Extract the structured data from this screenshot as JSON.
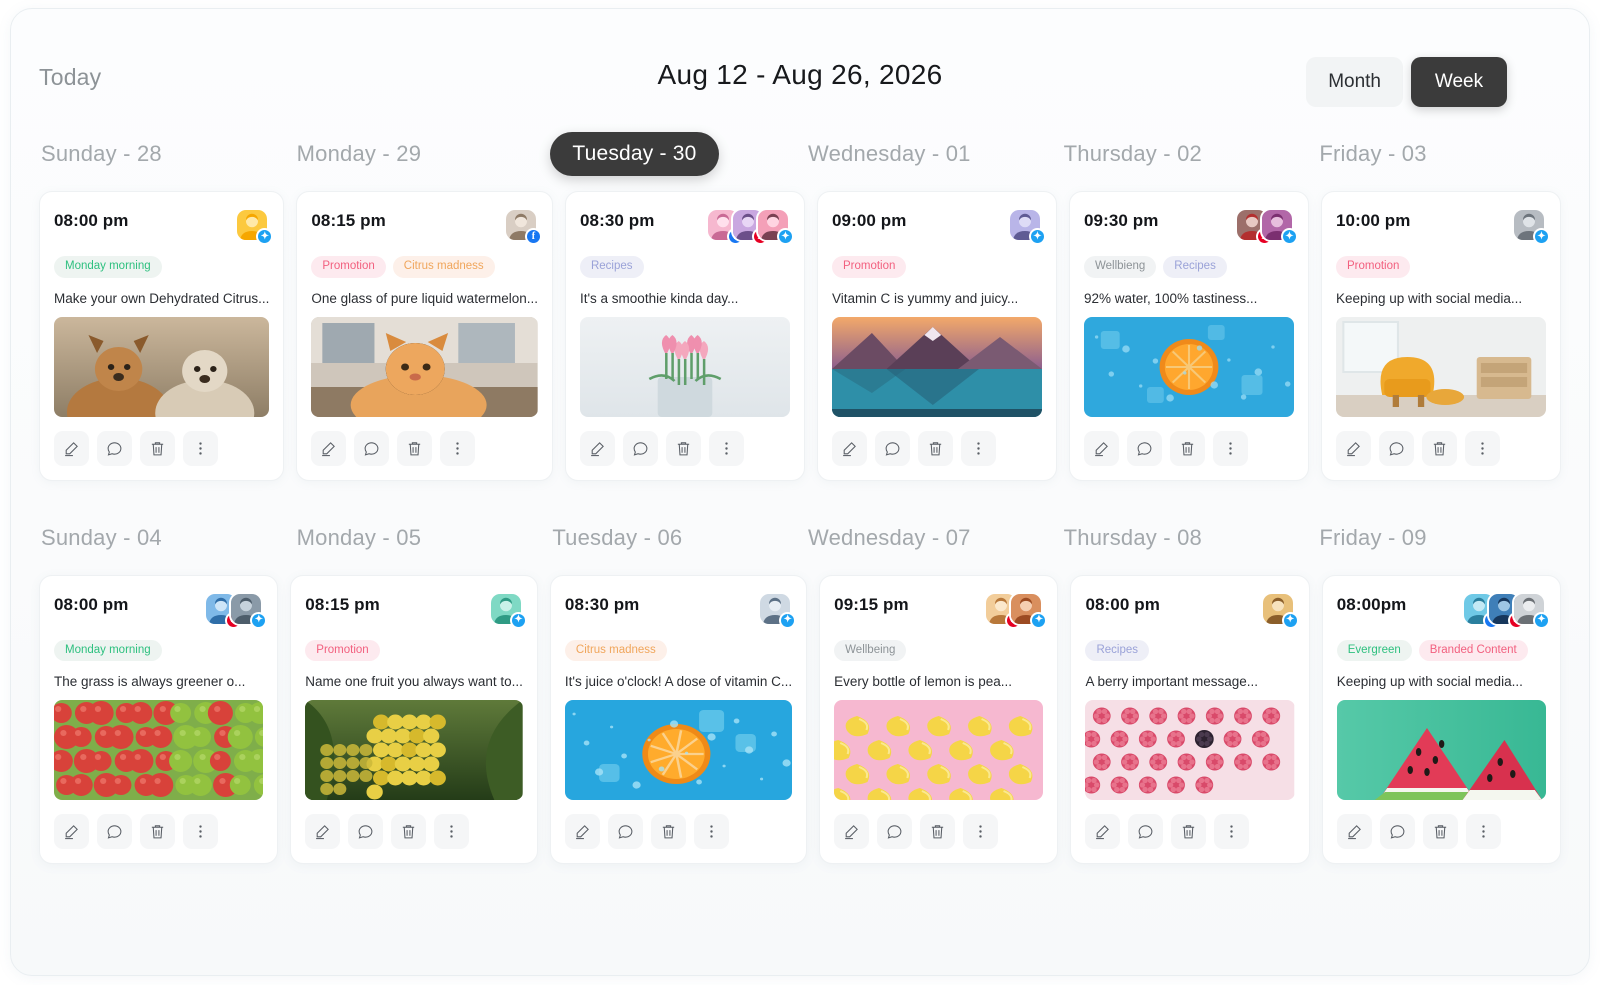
{
  "header": {
    "today_label": "Today",
    "date_range": "Aug 12 - Aug 26, 2026",
    "view_month": "Month",
    "view_week": "Week",
    "active_view": "Week"
  },
  "colors": {
    "accent_dark": "#3b3b3b",
    "tag_green": "#2ec07f",
    "tag_pink": "#f2607f",
    "tag_orange": "#f0a65c",
    "tag_purple": "#9aa2d8",
    "tag_grey": "#8d9397",
    "facebook": "#1877f2",
    "twitter": "#1da1f2",
    "pinterest": "#e60023"
  },
  "actions": [
    {
      "name": "edit-icon",
      "label": "Edit"
    },
    {
      "name": "comment-icon",
      "label": "Comment"
    },
    {
      "name": "delete-icon",
      "label": "Delete"
    },
    {
      "name": "more-options-icon",
      "label": "More"
    }
  ],
  "weeks": [
    {
      "days": [
        {
          "label": "Sunday - 28",
          "is_today": false,
          "card": {
            "time": "08:00 pm",
            "tags": [
              {
                "text": "Monday morning",
                "color": "green"
              }
            ],
            "text": "Make your own Dehydrated Citrus...",
            "avatars": [
              {
                "network": "twitter",
                "tone": "brand-yellow"
              }
            ],
            "thumb": "dogs"
          }
        },
        {
          "label": "Monday - 29",
          "is_today": false,
          "card": {
            "time": "08:15 pm",
            "tags": [
              {
                "text": "Promotion",
                "color": "pink"
              },
              {
                "text": "Citrus madness",
                "color": "orange"
              }
            ],
            "text": "One glass of pure liquid watermelon...",
            "avatars": [
              {
                "network": "facebook",
                "tone": "man-beard"
              }
            ],
            "thumb": "cat"
          }
        },
        {
          "label": "Tuesday - 30",
          "is_today": true,
          "card": {
            "time": "08:30 pm",
            "tags": [
              {
                "text": "Recipes",
                "color": "purple"
              }
            ],
            "text": "It's a smoothie kinda day...",
            "avatars": [
              {
                "network": "facebook",
                "tone": "pink-woman"
              },
              {
                "network": "pinterest",
                "tone": "violet-woman"
              },
              {
                "network": "twitter",
                "tone": "rose-man"
              }
            ],
            "thumb": "tulips"
          }
        },
        {
          "label": "Wednesday - 01",
          "is_today": false,
          "card": {
            "time": "09:00 pm",
            "tags": [
              {
                "text": "Promotion",
                "color": "pink"
              }
            ],
            "text": "Vitamin C is yummy and juicy...",
            "avatars": [
              {
                "network": "twitter",
                "tone": "lavender-man"
              }
            ],
            "thumb": "mountains"
          }
        },
        {
          "label": "Thursday - 02",
          "is_today": false,
          "card": {
            "time": "09:30 pm",
            "tags": [
              {
                "text": "Wellbieng",
                "color": "grey"
              },
              {
                "text": "Recipes",
                "color": "purple"
              }
            ],
            "text": "92% water, 100% tastiness...",
            "avatars": [
              {
                "network": "pinterest",
                "tone": "red-woman"
              },
              {
                "network": "twitter",
                "tone": "magenta-woman"
              }
            ],
            "thumb": "orange-ice"
          }
        },
        {
          "label": "Friday - 03",
          "is_today": false,
          "card": {
            "time": "10:00 pm",
            "tags": [
              {
                "text": "Promotion",
                "color": "pink"
              }
            ],
            "text": "Keeping up with social media...",
            "avatars": [
              {
                "network": "twitter",
                "tone": "grey-man"
              }
            ],
            "thumb": "chair"
          }
        }
      ]
    },
    {
      "days": [
        {
          "label": "Sunday - 04",
          "is_today": false,
          "card": {
            "time": "08:00 pm",
            "tags": [
              {
                "text": "Monday morning",
                "color": "green"
              }
            ],
            "text": "The grass is always greener o...",
            "avatars": [
              {
                "network": "pinterest",
                "tone": "blue-scene"
              },
              {
                "network": "twitter",
                "tone": "steel-woman"
              }
            ],
            "thumb": "apples"
          }
        },
        {
          "label": "Monday - 05",
          "is_today": false,
          "card": {
            "time": "08:15 pm",
            "tags": [
              {
                "text": "Promotion",
                "color": "pink"
              }
            ],
            "text": "Name one fruit you always want to...",
            "avatars": [
              {
                "network": "twitter",
                "tone": "mint-woman"
              }
            ],
            "thumb": "grapes"
          }
        },
        {
          "label": "Tuesday - 06",
          "is_today": false,
          "card": {
            "time": "08:30 pm",
            "tags": [
              {
                "text": "Citrus madness",
                "color": "orange"
              }
            ],
            "text": "It's juice o'clock! A dose of vitamin C...",
            "avatars": [
              {
                "network": "twitter",
                "tone": "pale-man"
              }
            ],
            "thumb": "orange-water"
          }
        },
        {
          "label": "Wednesday - 07",
          "is_today": false,
          "card": {
            "time": "09:15 pm",
            "tags": [
              {
                "text": "Wellbeing",
                "color": "grey"
              }
            ],
            "text": "Every bottle of lemon is pea...",
            "avatars": [
              {
                "network": "pinterest",
                "tone": "tan-woman"
              },
              {
                "network": "twitter",
                "tone": "copper-woman"
              }
            ],
            "thumb": "lemons-pink"
          }
        },
        {
          "label": "Thursday - 08",
          "is_today": false,
          "card": {
            "time": "08:00 pm",
            "tags": [
              {
                "text": "Recipes",
                "color": "purple"
              }
            ],
            "text": "A berry important message...",
            "avatars": [
              {
                "network": "twitter",
                "tone": "gold-woman"
              }
            ],
            "thumb": "raspberries"
          }
        },
        {
          "label": "Friday - 09",
          "is_today": false,
          "card": {
            "time": "08:00pm",
            "tags": [
              {
                "text": "Evergreen",
                "color": "green"
              },
              {
                "text": "Branded Content",
                "color": "pink"
              }
            ],
            "text": "Keeping up with social media...",
            "avatars": [
              {
                "network": "facebook",
                "tone": "cyan-woman"
              },
              {
                "network": "pinterest",
                "tone": "deepblue-man"
              },
              {
                "network": "twitter",
                "tone": "silver-woman"
              }
            ],
            "thumb": "watermelon"
          }
        }
      ]
    }
  ]
}
